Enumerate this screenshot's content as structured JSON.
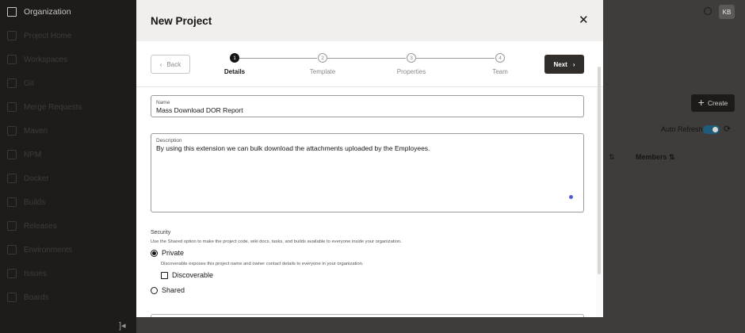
{
  "sidebar": {
    "items": [
      {
        "label": "Organization",
        "icon": "building-icon"
      },
      {
        "label": "Project Home",
        "icon": "home-icon"
      },
      {
        "label": "Workspaces",
        "icon": "workspaces-icon"
      },
      {
        "label": "Git",
        "icon": "git-icon"
      },
      {
        "label": "Merge Requests",
        "icon": "merge-icon"
      },
      {
        "label": "Maven",
        "icon": "maven-icon"
      },
      {
        "label": "NPM",
        "icon": "npm-icon"
      },
      {
        "label": "Docker",
        "icon": "docker-icon"
      },
      {
        "label": "Builds",
        "icon": "builds-icon"
      },
      {
        "label": "Releases",
        "icon": "releases-icon"
      },
      {
        "label": "Environments",
        "icon": "environments-icon"
      },
      {
        "label": "Issues",
        "icon": "issues-icon"
      },
      {
        "label": "Boards",
        "icon": "boards-icon"
      }
    ],
    "collapse_glyph": "]◂"
  },
  "header": {
    "avatar_initials": "KB"
  },
  "main": {
    "create_label": "Create",
    "auto_refresh_label": "Auto Refresh",
    "members_column": "Members"
  },
  "modal": {
    "title": "New Project",
    "close_glyph": "✕",
    "back_label": "Back",
    "next_label": "Next",
    "steps": [
      {
        "number": "1",
        "label": "Details"
      },
      {
        "number": "2",
        "label": "Template"
      },
      {
        "number": "3",
        "label": "Properties"
      },
      {
        "number": "4",
        "label": "Team"
      }
    ],
    "active_step": 1,
    "name_field": {
      "label": "Name",
      "value": "Mass Download DOR Report"
    },
    "description_field": {
      "label": "Description",
      "value": "By using this extension we can bulk download the attachments uploaded by the Employees."
    },
    "security": {
      "title": "Security",
      "help": "Use the Shared option to make the project code, wiki docs, tasks, and builds available to everyone inside your organization.",
      "private_label": "Private",
      "private_checked": true,
      "discoverable_help": "Discoverable exposes this project name and owner contact details to everyone in your organization.",
      "discoverable_label": "Discoverable",
      "discoverable_checked": false,
      "shared_label": "Shared",
      "shared_checked": false
    }
  },
  "colors": {
    "sidebar_bg": "#1d1c1b",
    "overlay_bg": "#3e3d3b",
    "modal_header_bg": "#f1efed",
    "primary_button": "#312d2a",
    "accent_dot": "#4f5bd5"
  }
}
